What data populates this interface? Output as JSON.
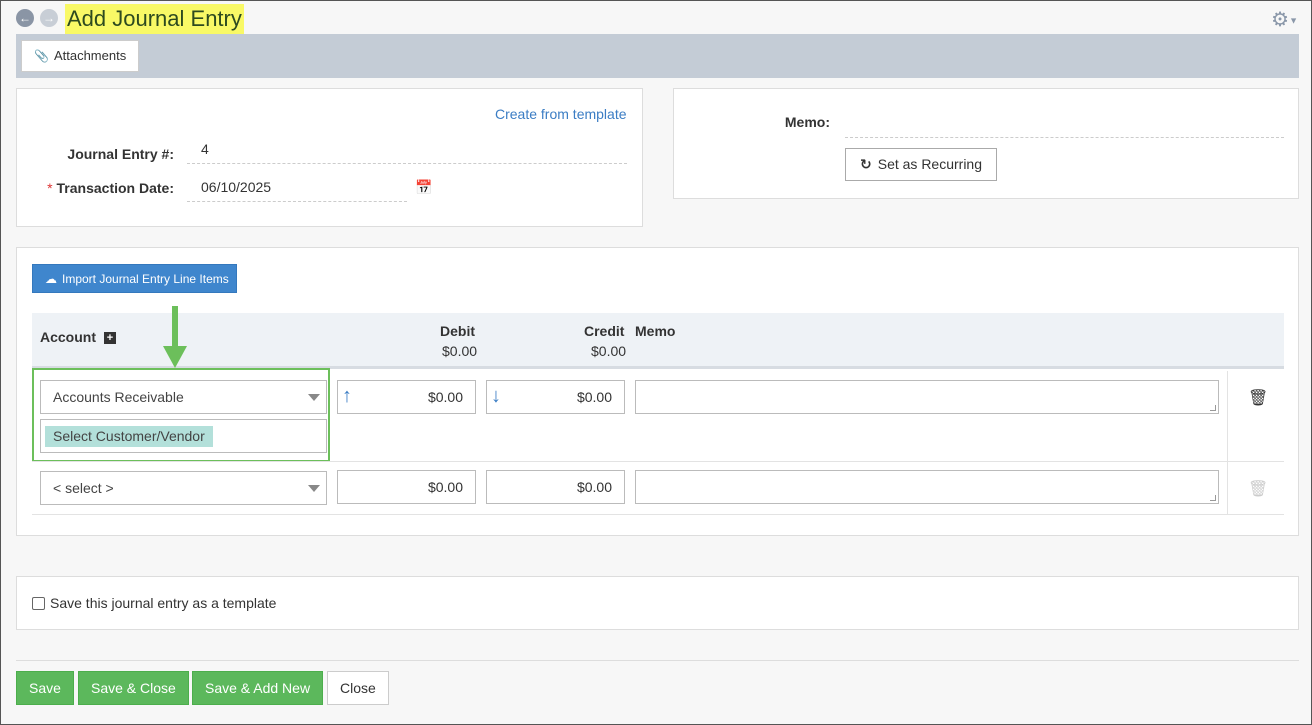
{
  "header": {
    "title": "Add Journal Entry",
    "back_icon": "arrow-left-circle-icon",
    "forward_icon": "arrow-right-circle-icon",
    "settings_icon": "gear-icon"
  },
  "toolbar": {
    "attachments_label": "Attachments"
  },
  "entry_panel": {
    "template_link": "Create from template",
    "journal_entry_label": "Journal Entry #:",
    "journal_entry_value": "4",
    "transaction_date_required": "*",
    "transaction_date_label": "Transaction Date:",
    "transaction_date_value": "06/10/2025"
  },
  "memo_panel": {
    "memo_label": "Memo:",
    "memo_value": "",
    "recurring_label": "Set as Recurring"
  },
  "lines": {
    "import_label": "Import Journal Entry Line Items",
    "columns": {
      "account": "Account",
      "debit": "Debit",
      "debit_total": "$0.00",
      "credit": "Credit",
      "credit_total": "$0.00",
      "memo": "Memo"
    },
    "rows": [
      {
        "account": "Accounts Receivable",
        "customer_vendor": "Select Customer/Vendor",
        "debit": "$0.00",
        "credit": "$0.00",
        "memo": ""
      },
      {
        "account": "< select >",
        "debit": "$0.00",
        "credit": "$0.00",
        "memo": ""
      }
    ]
  },
  "template_option": {
    "label": "Save this journal entry as a template",
    "checked": false
  },
  "footer": {
    "save": "Save",
    "save_close": "Save & Close",
    "save_add_new": "Save & Add New",
    "close": "Close"
  },
  "colors": {
    "title_highlight": "#f9f966",
    "primary_blue": "#3f86cd",
    "save_green": "#5cb85c",
    "annotation_green": "#6cbf5b",
    "customer_tag": "#b3e0da"
  }
}
